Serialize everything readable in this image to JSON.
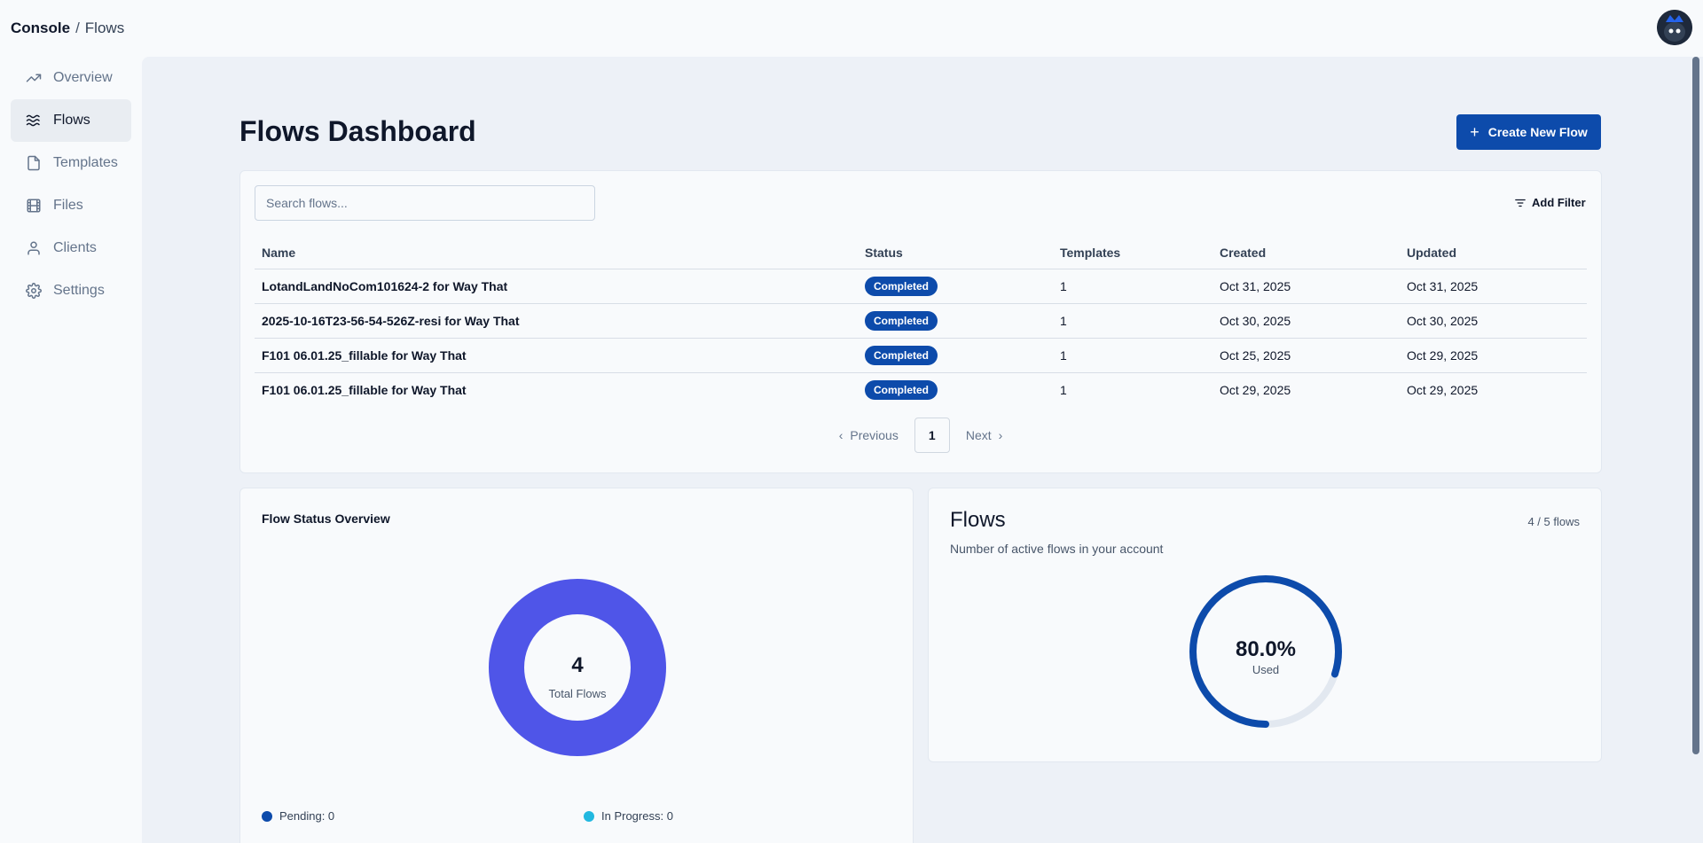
{
  "breadcrumb": {
    "root": "Console",
    "separator": "/",
    "current": "Flows"
  },
  "sidebar": {
    "items": [
      {
        "label": "Overview",
        "icon": "trending-up-icon",
        "active": false
      },
      {
        "label": "Flows",
        "icon": "waves-icon",
        "active": true
      },
      {
        "label": "Templates",
        "icon": "file-icon",
        "active": false
      },
      {
        "label": "Files",
        "icon": "film-icon",
        "active": false
      },
      {
        "label": "Clients",
        "icon": "user-icon",
        "active": false
      },
      {
        "label": "Settings",
        "icon": "gear-icon",
        "active": false
      }
    ]
  },
  "page": {
    "title": "Flows Dashboard",
    "create_label": "Create New Flow"
  },
  "toolbar": {
    "search_placeholder": "Search flows...",
    "filter_label": "Add Filter"
  },
  "table": {
    "columns": [
      "Name",
      "Status",
      "Templates",
      "Created",
      "Updated"
    ],
    "rows": [
      {
        "name": "LotandLandNoCom101624-2 for Way That",
        "status": "Completed",
        "templates": "1",
        "created": "Oct 31, 2025",
        "updated": "Oct 31, 2025"
      },
      {
        "name": "2025-10-16T23-56-54-526Z-resi for Way That",
        "status": "Completed",
        "templates": "1",
        "created": "Oct 30, 2025",
        "updated": "Oct 30, 2025"
      },
      {
        "name": "F101 06.01.25_fillable for Way That",
        "status": "Completed",
        "templates": "1",
        "created": "Oct 25, 2025",
        "updated": "Oct 29, 2025"
      },
      {
        "name": "F101 06.01.25_fillable for Way That",
        "status": "Completed",
        "templates": "1",
        "created": "Oct 29, 2025",
        "updated": "Oct 29, 2025"
      }
    ]
  },
  "pagination": {
    "previous": "Previous",
    "page": "1",
    "next": "Next"
  },
  "status_overview": {
    "title": "Flow Status Overview",
    "total": "4",
    "total_label": "Total Flows",
    "legend": [
      {
        "label": "Pending: 0",
        "color": "#0d4bab"
      },
      {
        "label": "In Progress: 0",
        "color": "#22b8e0"
      }
    ]
  },
  "flows_usage": {
    "title": "Flows",
    "subtitle": "Number of active flows in your account",
    "count": "4 / 5 flows",
    "percent_label": "80.0%",
    "used_label": "Used"
  },
  "chart_data": [
    {
      "type": "pie",
      "labels": [
        "Completed"
      ],
      "values": [
        4
      ],
      "colors": [
        "#4f55e8"
      ]
    },
    {
      "type": "gauge",
      "value": 0.8,
      "colors": [
        "#0d4bab",
        "#e2e8f0"
      ]
    }
  ]
}
